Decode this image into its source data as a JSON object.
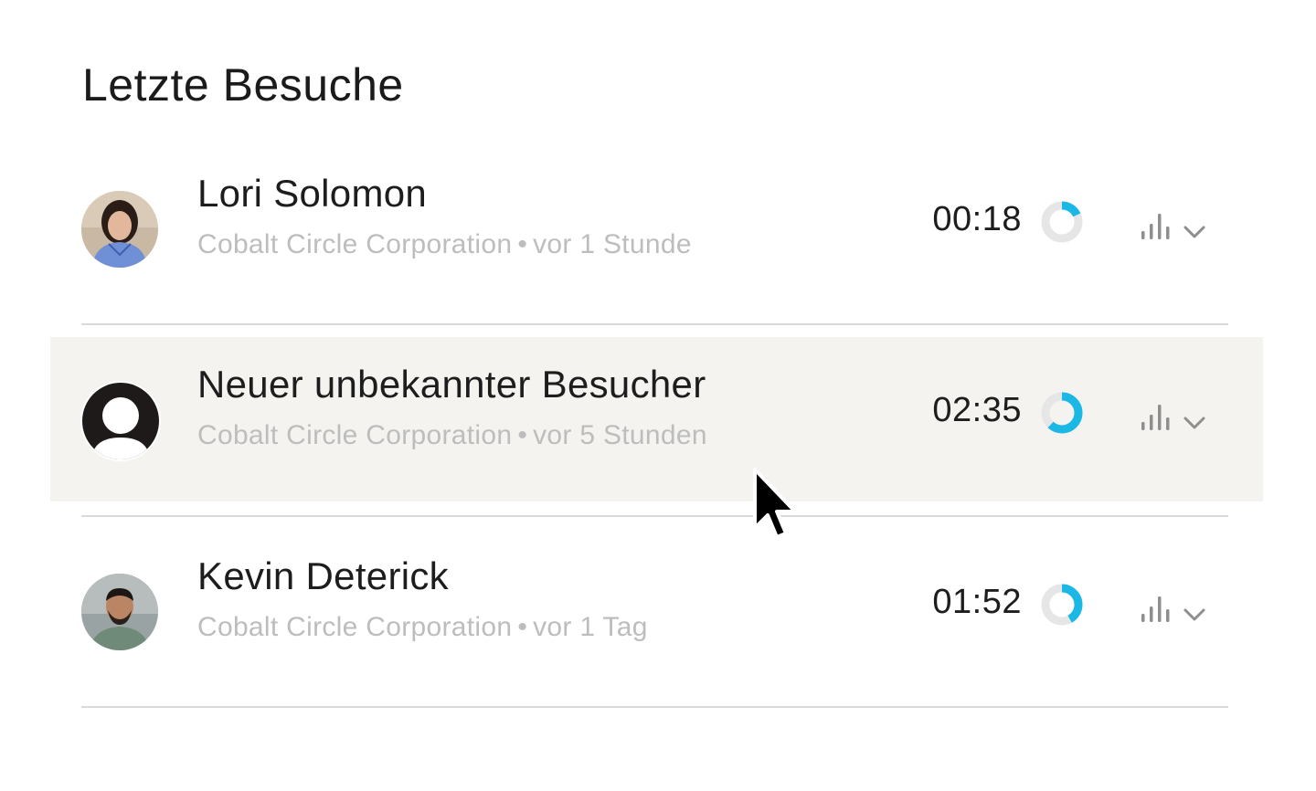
{
  "page": {
    "title": "Letzte Besuche"
  },
  "colors": {
    "accent": "#1bb8e6",
    "ring_track": "#e6e6e6",
    "hover_bg": "#f4f3f0",
    "meta_text": "#bdbdbd"
  },
  "visits": [
    {
      "name": "Lori Solomon",
      "company": "Cobalt Circle Corporation",
      "separator": "•",
      "time_ago": "vor 1 Stunde",
      "duration": "00:18",
      "progress": 0.18,
      "avatar": "photo-woman"
    },
    {
      "name": "Neuer unbekannter Besucher",
      "company": "Cobalt Circle Corporation",
      "separator": "•",
      "time_ago": "vor 5 Stunden",
      "duration": "02:35",
      "progress": 0.62,
      "avatar": "unknown-person-icon"
    },
    {
      "name": "Kevin Deterick",
      "company": "Cobalt Circle Corporation",
      "separator": "•",
      "time_ago": "vor 1 Tag",
      "duration": "01:52",
      "progress": 0.42,
      "avatar": "photo-man"
    }
  ]
}
